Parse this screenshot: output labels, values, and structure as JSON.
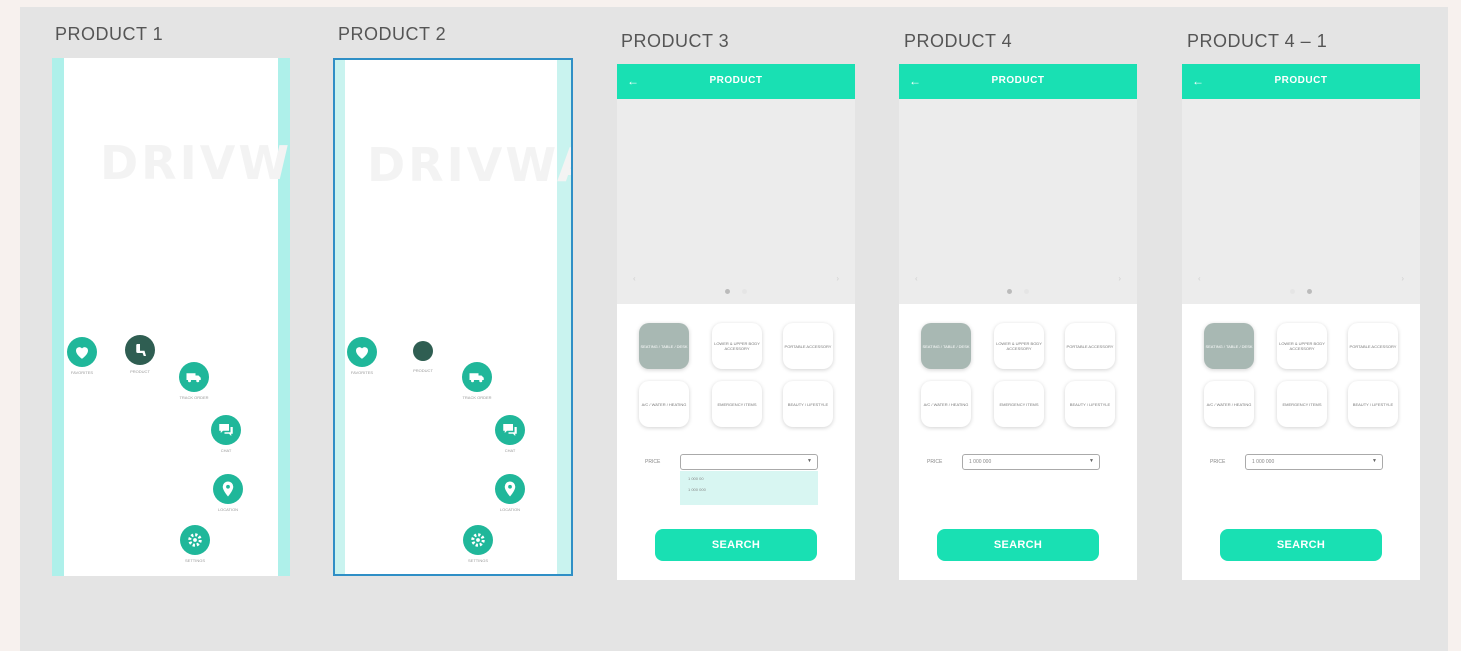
{
  "artboards": [
    {
      "title": "PRODUCT 1"
    },
    {
      "title": "PRODUCT 2"
    },
    {
      "title": "PRODUCT 3"
    },
    {
      "title": "PRODUCT 4"
    },
    {
      "title": "PRODUCT 4 – 1"
    }
  ],
  "splash": {
    "watermark": "DRIVWAY",
    "menu": {
      "favorites": "FAVORITES",
      "product": "PRODUCT",
      "track_order": "TRACK ORDER",
      "chat": "CHAT",
      "location": "LOCATION",
      "settings": "SETTINGS"
    }
  },
  "product_screen": {
    "header_title": "PRODUCT",
    "back_icon": "arrow-left-icon",
    "categories": [
      "SEATING / TABLE / DESK",
      "LOWER & UPPER BODY ACCESSORY",
      "PORTABLE ACCESSORY",
      "A/C / WATER / HEATING",
      "EMERGENCY ITEMS",
      "BEAUTY / LIFESTYLE"
    ],
    "price_label": "PRICE",
    "price_value": "1 000 000",
    "dropdown_options": [
      "1 000 00",
      "1 000 000"
    ],
    "search_label": "SEARCH"
  },
  "colors": {
    "accent": "#19e0b3",
    "menu_teal": "#20b79a",
    "menu_dark": "#2f5e52",
    "selected_category": "#a8b8b3",
    "artboard_selection": "#2f8fc6"
  }
}
